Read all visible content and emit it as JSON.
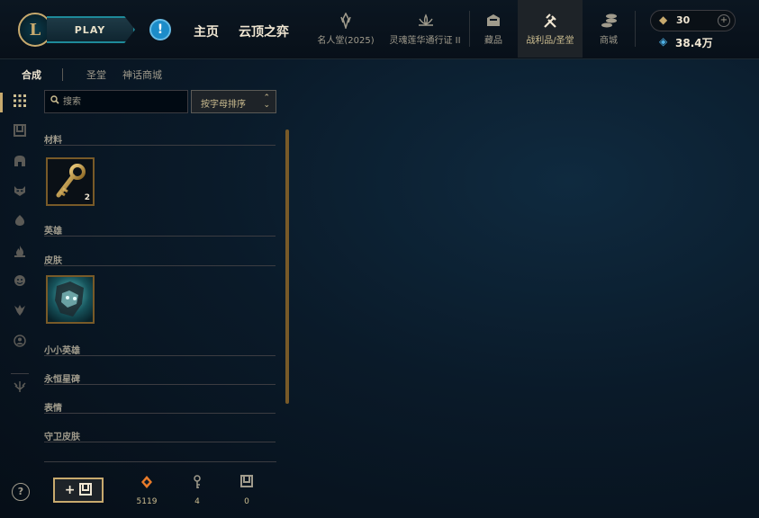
{
  "header": {
    "logo_letter": "L",
    "play_label": "PLAY",
    "alert_glyph": "!",
    "nav_home": "主页",
    "nav_tft": "云顶之弈",
    "nav_items": [
      {
        "label": "名人堂(2025)",
        "icon": "hall-of-fame-icon"
      },
      {
        "label": "灵魂莲华通行证 II",
        "icon": "lotus-icon"
      },
      {
        "label": "藏品",
        "icon": "collection-icon"
      },
      {
        "label": "战利品/圣堂",
        "icon": "loot-icon"
      },
      {
        "label": "商城",
        "icon": "store-icon"
      }
    ],
    "rp_value": "30",
    "be_value": "38.4万"
  },
  "subtabs": [
    "合成",
    "圣堂",
    "神话商城"
  ],
  "search": {
    "placeholder": "搜索"
  },
  "sort": {
    "label": "按字母排序"
  },
  "categories": [
    "材料",
    "英雄",
    "皮肤",
    "小小英雄",
    "永恒星碑",
    "表情",
    "守卫皮肤"
  ],
  "material_tile": {
    "count": "2"
  },
  "footer": {
    "help_glyph": "?",
    "add_label": "+ ",
    "stats": [
      {
        "icon": "orange-essence-icon",
        "value": "5119",
        "color": "#e87b2a"
      },
      {
        "icon": "key-icon",
        "value": "4",
        "color": "#a09b8c"
      },
      {
        "icon": "chest-icon",
        "value": "0",
        "color": "#a09b8c"
      }
    ]
  }
}
